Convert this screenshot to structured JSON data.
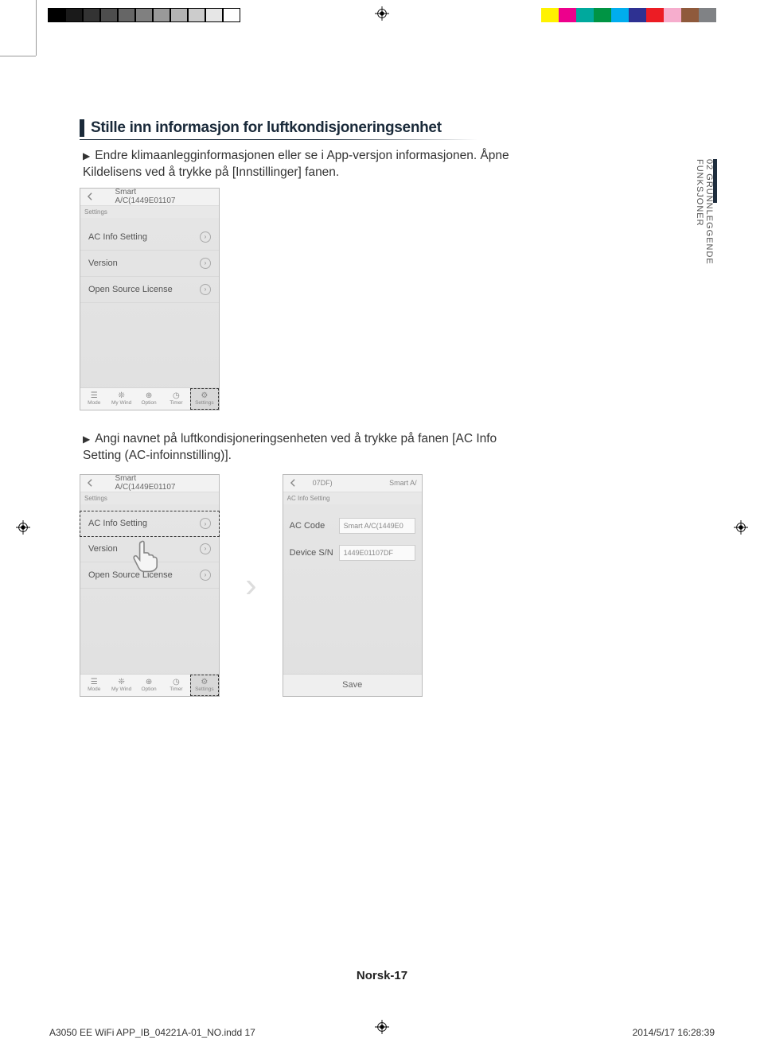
{
  "print": {
    "gray_swatches": [
      "#000",
      "#1a1a1a",
      "#333",
      "#4d4d4d",
      "#666",
      "#808080",
      "#999",
      "#b3b3b3",
      "#ccc",
      "#e6e6e6",
      "#fff"
    ],
    "color_swatches": [
      "#fff200",
      "#ed008c",
      "#00a99d",
      "#009444",
      "#00adee",
      "#2e3192",
      "#ec1c24",
      "#f6adcd",
      "#8f5a3c",
      "#808285"
    ],
    "indd_line": "A3050 EE WiFi APP_IB_04221A-01_NO.indd   17",
    "timestamp": "2014/5/17   16:28:39"
  },
  "side_tab": "02  GRUNNLEGGENDE FUNKSJONER",
  "heading": "Stille inn informasjon for luftkondisjoneringsenhet",
  "bullet1": "Endre klimaanlegginformasjonen eller se i App-versjon informasjonen. Åpne Kildelisens ved å trykke på [Innstillinger] fanen.",
  "bullet2": "Angi navnet på luftkondisjoneringsenheten ved å trykke på fanen [AC Info Setting (AC-infoinnstilling)].",
  "phone": {
    "header_title": "Smart A/C(1449E01107",
    "header_title_b": "07DF)",
    "header_title_b_right": "Smart A/",
    "tab_settings": "Settings",
    "tab_acinfo": "AC Info Setting",
    "rows": {
      "ac_info": "AC Info Setting",
      "version": "Version",
      "license": "Open Source License"
    },
    "footer": {
      "mode": "Mode",
      "mywind": "My Wind",
      "option": "Option",
      "timer": "Timer",
      "settings": "Settings"
    },
    "acinfo": {
      "ac_code_label": "AC Code",
      "ac_code_value": "Smart A/C(1449E0",
      "sn_label": "Device S/N",
      "sn_value": "1449E01107DF",
      "save": "Save"
    }
  },
  "page_number": "Norsk-17"
}
